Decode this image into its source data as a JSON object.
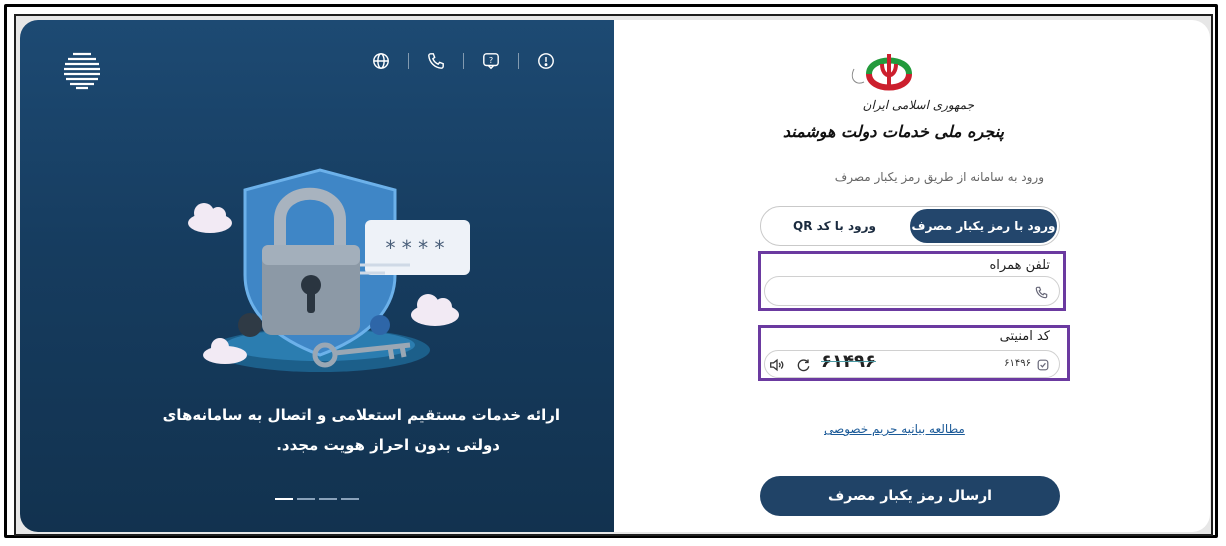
{
  "brand": {
    "gov_name": "جمهوری اسلامی ایران",
    "portal_name": "پنجره ملی خدمات دولت هوشمند"
  },
  "login": {
    "subtitle": "ورود به سامانه از طریق رمز یکبار مصرف",
    "tabs": [
      {
        "label": "ورود با رمز یکبار مصرف",
        "active": true
      },
      {
        "label": "ورود با کد QR",
        "active": false
      }
    ],
    "phone_label": "تلفن همراه",
    "phone_value": "",
    "captcha_label": "کد امنیتی",
    "captcha_value": "۶۱۴۹۶",
    "captcha_image_text": "۶۱۴۹۶",
    "privacy_link": "مطالعه بیانیه حریم خصوصی",
    "submit_label": "ارسال رمز یکبار مصرف"
  },
  "promo": {
    "line1": "ارائه خدمات مستقیم استعلامی و اتصال به سامانه‌های",
    "line2": "دولتی بدون احراز هویت مجدد.",
    "password_mask": "* * * *"
  },
  "icons": {
    "topbar": [
      "globe-icon",
      "phone-icon",
      "chat-help-icon",
      "info-icon"
    ],
    "phone_field": "phone-icon",
    "captcha": [
      "checkbox-icon",
      "refresh-icon",
      "speaker-icon"
    ]
  },
  "colors": {
    "panel": "#1d4a73",
    "button": "#204367",
    "highlight": "#6b3aa0",
    "link": "#1b5a98"
  },
  "slider": {
    "count": 4,
    "active_index": 0
  }
}
